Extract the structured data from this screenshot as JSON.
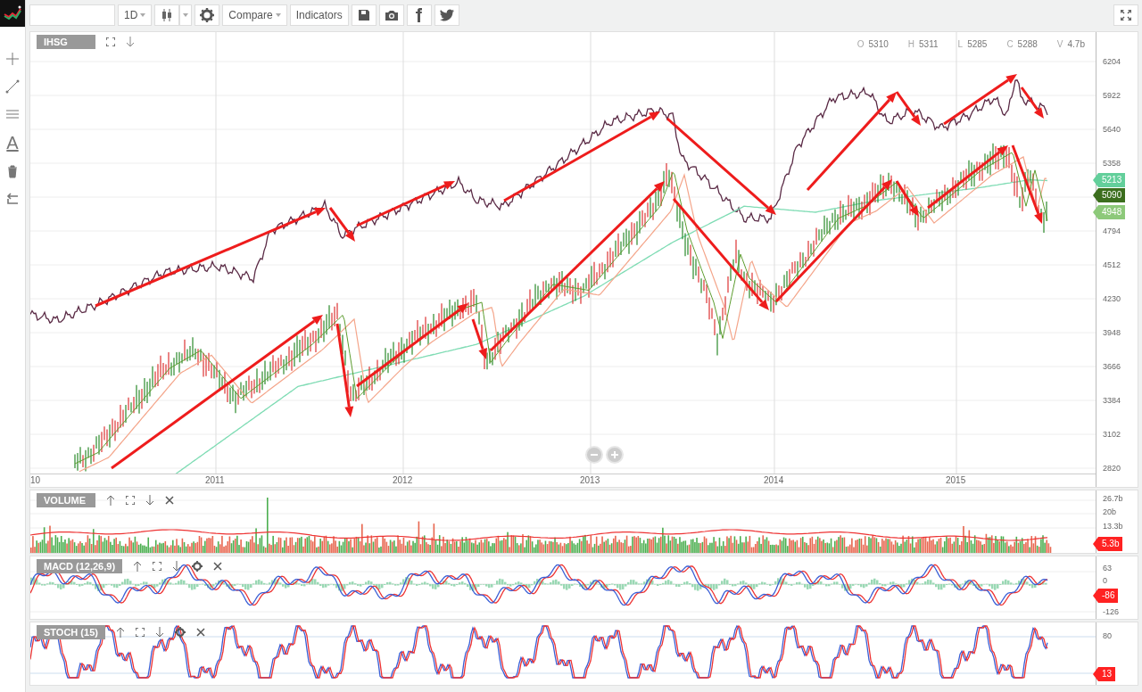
{
  "toolbar": {
    "interval": "1D",
    "compare": "Compare",
    "indicators": "Indicators"
  },
  "left_tools": {
    "text_tool": "A"
  },
  "main_chart": {
    "symbol": "IHSG",
    "ohlcv": [
      {
        "label": "O",
        "value": "5310"
      },
      {
        "label": "H",
        "value": "5311"
      },
      {
        "label": "L",
        "value": "5285"
      },
      {
        "label": "C",
        "value": "5288"
      },
      {
        "label": "V",
        "value": "4.7b"
      }
    ],
    "y_ticks": [
      "6204",
      "5922",
      "5640",
      "5358",
      "4794",
      "4512",
      "4230",
      "3948",
      "3666",
      "3384",
      "3102",
      "2820"
    ],
    "x_labels": [
      "10",
      "2011",
      "2012",
      "2013",
      "2014",
      "2015"
    ],
    "price_tags": [
      {
        "value": "5213",
        "color": "#63cf9b"
      },
      {
        "value": "5090",
        "color": "#3c6e1e"
      },
      {
        "value": "4948",
        "color": "#8dc97a"
      }
    ]
  },
  "panels": [
    {
      "kind": "volume",
      "title": "VOLUME",
      "ticks": [
        "26.7b",
        "20b",
        "13.3b"
      ],
      "tag": "5.3b"
    },
    {
      "kind": "macd",
      "title": "MACD (12,26,9)",
      "ticks": [
        "63",
        "0",
        "-126"
      ],
      "tag": "-86"
    },
    {
      "kind": "stoch",
      "title": "STOCH (15)",
      "ticks": [
        "80"
      ],
      "tag": "13"
    }
  ]
}
